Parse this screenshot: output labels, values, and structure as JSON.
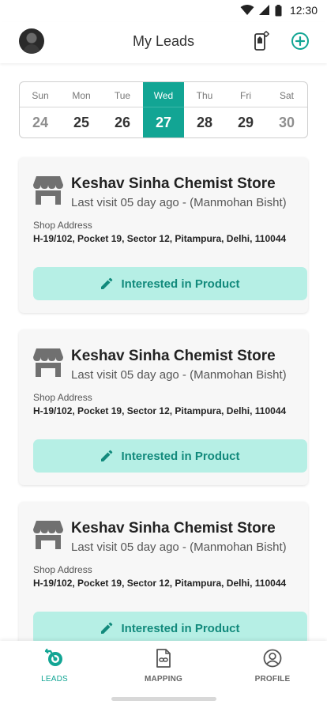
{
  "status_bar": {
    "time": "12:30"
  },
  "header": {
    "title": "My Leads"
  },
  "calendar": {
    "days": [
      {
        "name": "Sun",
        "num": "24"
      },
      {
        "name": "Mon",
        "num": "25"
      },
      {
        "name": "Tue",
        "num": "26"
      },
      {
        "name": "Wed",
        "num": "27"
      },
      {
        "name": "Thu",
        "num": "28"
      },
      {
        "name": "Fri",
        "num": "29"
      },
      {
        "name": "Sat",
        "num": "30"
      }
    ],
    "selected_index": 3
  },
  "leads": [
    {
      "store_name": "Keshav Sinha Chemist Store",
      "last_visit": "Last visit 05 day ago - (Manmohan Bisht)",
      "address_label": "Shop Address",
      "address": "H-19/102, Pocket 19, Sector 12, Pitampura, Delhi, 110044",
      "action_label": "Interested in Product"
    },
    {
      "store_name": "Keshav Sinha Chemist Store",
      "last_visit": "Last visit 05 day ago - (Manmohan Bisht)",
      "address_label": "Shop Address",
      "address": "H-19/102, Pocket 19, Sector 12, Pitampura, Delhi, 110044",
      "action_label": "Interested in Product"
    },
    {
      "store_name": "Keshav Sinha Chemist Store",
      "last_visit": "Last visit 05 day ago - (Manmohan Bisht)",
      "address_label": "Shop Address",
      "address": "H-19/102, Pocket 19, Sector 12, Pitampura, Delhi, 110044",
      "action_label": "Interested in Product"
    }
  ],
  "bottom_nav": {
    "items": [
      {
        "label": "LEADS",
        "icon": "leads-icon",
        "active": true
      },
      {
        "label": "MAPPING",
        "icon": "mapping-icon",
        "active": false
      },
      {
        "label": "PROFILE",
        "icon": "profile-icon",
        "active": false
      }
    ]
  },
  "colors": {
    "accent": "#12a594",
    "button_bg": "#b6efe5",
    "button_text": "#128a7c"
  }
}
